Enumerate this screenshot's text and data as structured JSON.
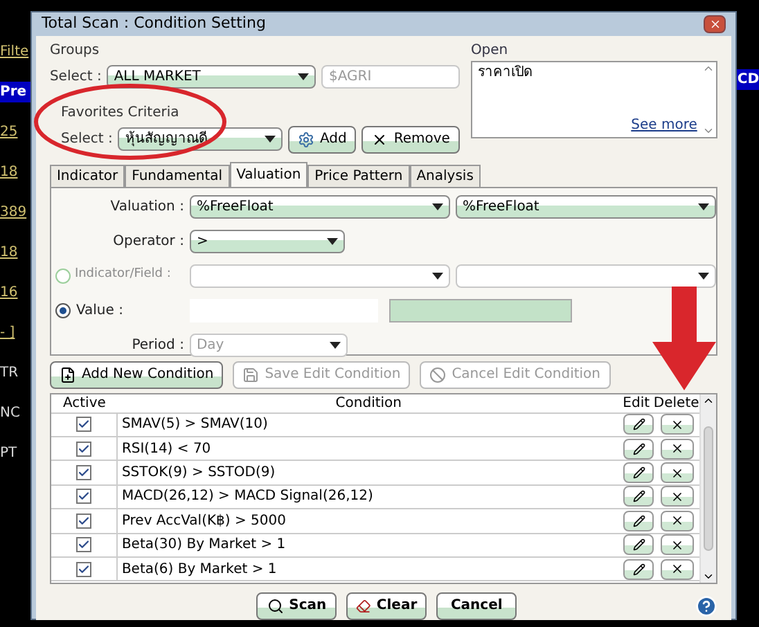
{
  "background": {
    "left_texts": [
      "Filte",
      "Pre",
      "25",
      "18",
      "389",
      "18",
      "16",
      "- ]",
      "TR",
      "NC",
      "PT"
    ],
    "right_text": "CD"
  },
  "window": {
    "title": "Total Scan : Condition Setting"
  },
  "groups": {
    "label": "Groups",
    "select_label": "Select :",
    "value": "ALL MARKET",
    "sub_value": "$AGRI"
  },
  "open": {
    "label": "Open",
    "text": "ราคาเปิด",
    "link": "See more"
  },
  "favorites": {
    "label": "Favorites Criteria",
    "select_label": "Select :",
    "value": "หุ้นสัญญาณดี",
    "add": "Add",
    "remove": "Remove"
  },
  "tabs": [
    {
      "label": "Indicator",
      "selected": false
    },
    {
      "label": "Fundamental",
      "selected": false
    },
    {
      "label": "Valuation",
      "selected": true
    },
    {
      "label": "Price Pattern",
      "selected": false
    },
    {
      "label": "Analysis",
      "selected": false
    }
  ],
  "valuation": {
    "label": "Valuation :",
    "values": [
      "%FreeFloat",
      "%FreeFloat"
    ]
  },
  "operator": {
    "label": "Operator :",
    "value": ">"
  },
  "indicator": {
    "label": "Indicator/Field :",
    "selected": false,
    "disabled": true
  },
  "value": {
    "label": "Value :",
    "selected": true
  },
  "period": {
    "label": "Period :",
    "value": "Day",
    "disabled": true
  },
  "action_buttons": [
    {
      "kind": "add",
      "label": "Add New Condition",
      "disabled": false
    },
    {
      "kind": "save",
      "label": "Save Edit Condition",
      "disabled": true
    },
    {
      "kind": "cancel",
      "label": "Cancel Edit Condition",
      "disabled": true
    }
  ],
  "table": {
    "columns": [
      "Active",
      "Condition",
      "Edit",
      "Delete"
    ],
    "rows": [
      {
        "condition": "SMAV(5) > SMAV(10)",
        "active": true
      },
      {
        "condition": "RSI(14) < 70",
        "active": true
      },
      {
        "condition": "SSTOK(9) > SSTOD(9)",
        "active": true
      },
      {
        "condition": "MACD(26,12) > MACD Signal(26,12)",
        "active": true
      },
      {
        "condition": "Prev AccVal(K฿) > 5000",
        "active": true
      },
      {
        "condition": "Beta(30) By Market > 1",
        "active": true
      },
      {
        "condition": "Beta(6) By Market > 1",
        "active": true
      }
    ]
  },
  "footer_buttons": [
    {
      "kind": "scan",
      "label": "Scan"
    },
    {
      "kind": "clear",
      "label": "Clear"
    },
    {
      "kind": "cancel",
      "label": "Cancel"
    }
  ]
}
